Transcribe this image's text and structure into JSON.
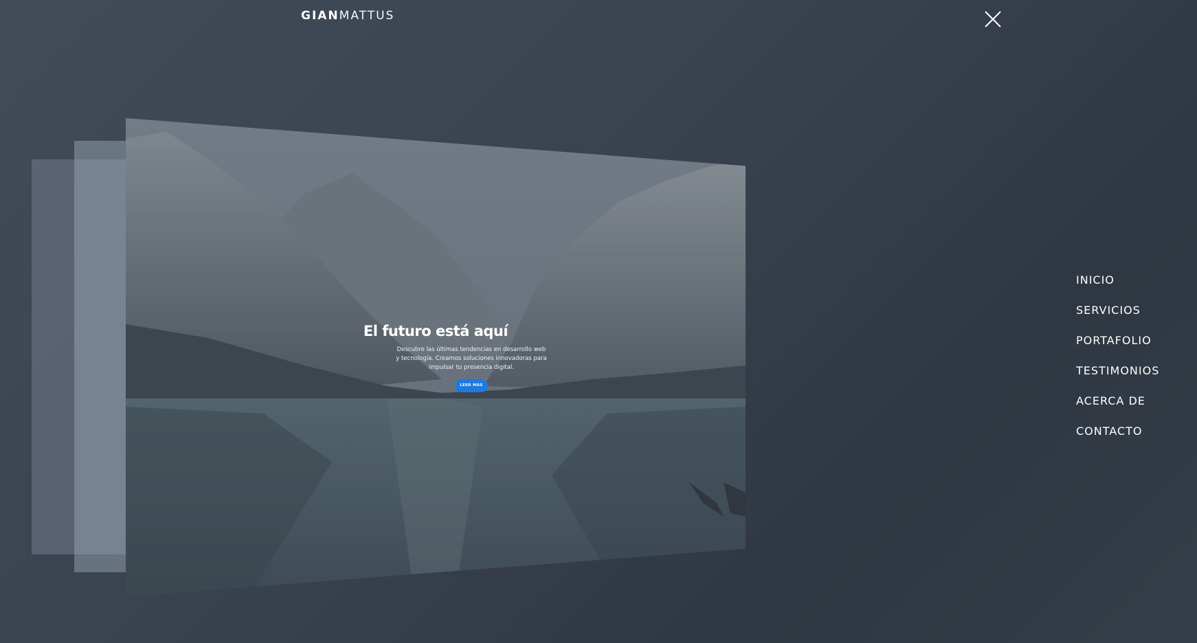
{
  "brand": {
    "name_bold": "GIAN",
    "name_light": "MATTUS"
  },
  "header": {
    "close_icon": "close-icon"
  },
  "preview": {
    "title": "El futuro está aquí",
    "description": "Descubre las últimas tendencias en desarrollo web y tecnología. Creamos soluciones innovadoras para impulsar tu presencia digital.",
    "button_label": "LEER MÁS"
  },
  "menu": {
    "items": [
      {
        "label": "INICIO"
      },
      {
        "label": "SERVICIOS"
      },
      {
        "label": "PORTAFOLIO"
      },
      {
        "label": "TESTIMONIOS"
      },
      {
        "label": "ACERCA DE"
      },
      {
        "label": "CONTACTO"
      }
    ]
  },
  "colors": {
    "background": "#3a4350",
    "accent_button": "#1f7ae0",
    "text": "#ffffff"
  }
}
